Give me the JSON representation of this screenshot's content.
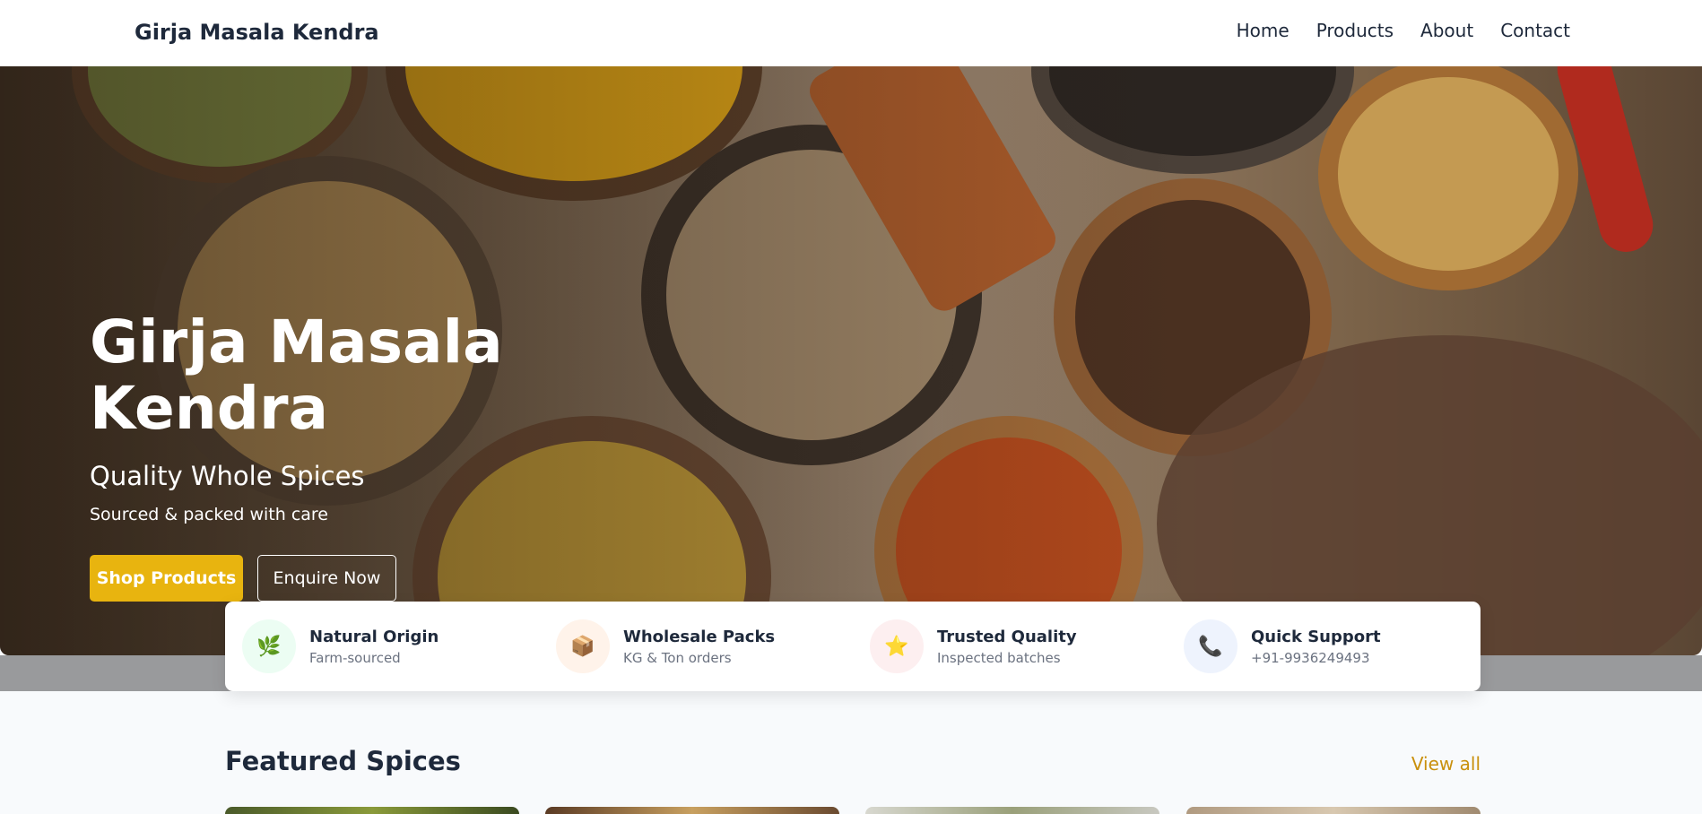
{
  "header": {
    "brand": "Girja Masala Kendra",
    "nav": [
      "Home",
      "Products",
      "About",
      "Contact"
    ]
  },
  "hero": {
    "title": "Girja Masala Kendra",
    "subtitle": "Quality Whole Spices",
    "note": "Sourced & packed with care",
    "primary_button": "Shop Products",
    "secondary_button": "Enquire Now"
  },
  "features": [
    {
      "title": "Natural Origin",
      "subtitle": "Farm-sourced",
      "icon": "herb-icon",
      "glyph": "🌿",
      "bg": "#ecfdf3"
    },
    {
      "title": "Wholesale Packs",
      "subtitle": "KG & Ton orders",
      "icon": "package-icon",
      "glyph": "📦",
      "bg": "#fff3ea"
    },
    {
      "title": "Trusted Quality",
      "subtitle": "Inspected batches",
      "icon": "star-icon",
      "glyph": "⭐",
      "bg": "#fdeff0"
    },
    {
      "title": "Quick Support",
      "subtitle": "+91-9936249493",
      "icon": "phone-icon",
      "glyph": "📞",
      "bg": "#eef3fd"
    }
  ],
  "featured": {
    "title": "Featured Spices",
    "view_all": "View all"
  },
  "colors": {
    "accent": "#e8b40f",
    "link": "#c9900c",
    "text": "#1e293b"
  }
}
